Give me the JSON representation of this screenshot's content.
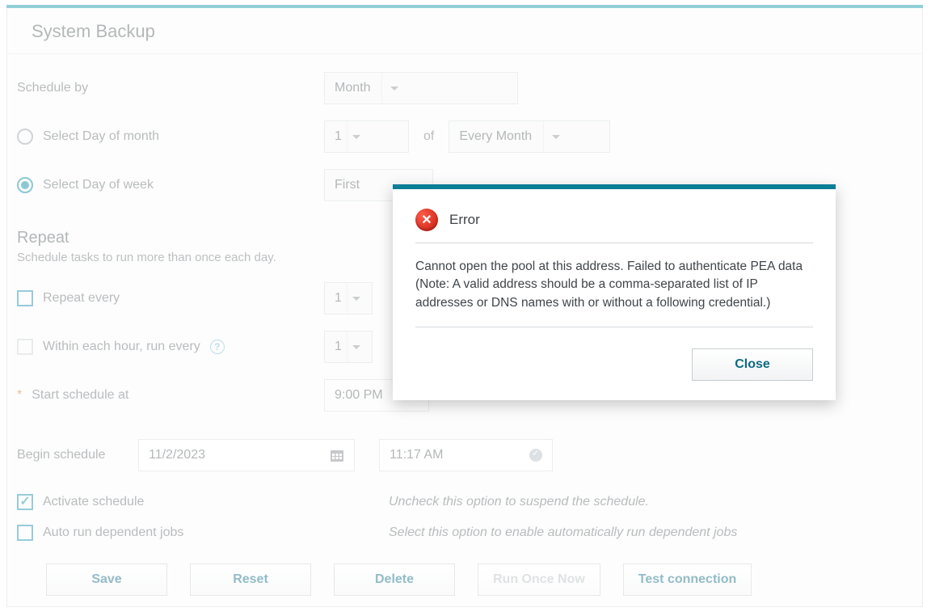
{
  "page": {
    "title": "System Backup"
  },
  "schedule": {
    "schedule_by_label": "Schedule by",
    "schedule_by_value": "Month",
    "day_of_month_label": "Select Day of month",
    "day_of_month_value": "1",
    "of_label": "of",
    "every_month_value": "Every Month",
    "day_of_week_label": "Select Day of week",
    "day_of_week_value": "First"
  },
  "repeat": {
    "heading": "Repeat",
    "sub": "Schedule tasks to run more than once each day.",
    "repeat_every_label": "Repeat every",
    "repeat_every_value": "1",
    "within_each_hour_label": "Within each hour, run every",
    "within_each_hour_value": "1",
    "start_schedule_label": "Start schedule at",
    "start_schedule_value": "9:00 PM"
  },
  "begin": {
    "label": "Begin schedule",
    "date": "11/2/2023",
    "time": "11:17 AM"
  },
  "activate": {
    "label": "Activate schedule",
    "hint": "Uncheck this option to suspend the schedule."
  },
  "auto_run": {
    "label": "Auto run dependent jobs",
    "hint": "Select this option to enable automatically run dependent jobs"
  },
  "buttons": {
    "save": "Save",
    "reset": "Reset",
    "delete": "Delete",
    "run_once": "Run Once Now",
    "test": "Test connection"
  },
  "modal": {
    "title": "Error",
    "message": "Cannot open the pool at this address. Failed to authenticate PEA data (Note: A valid address should be a comma-separated list of IP addresses or DNS names with or without a following credential.)",
    "close": "Close"
  }
}
